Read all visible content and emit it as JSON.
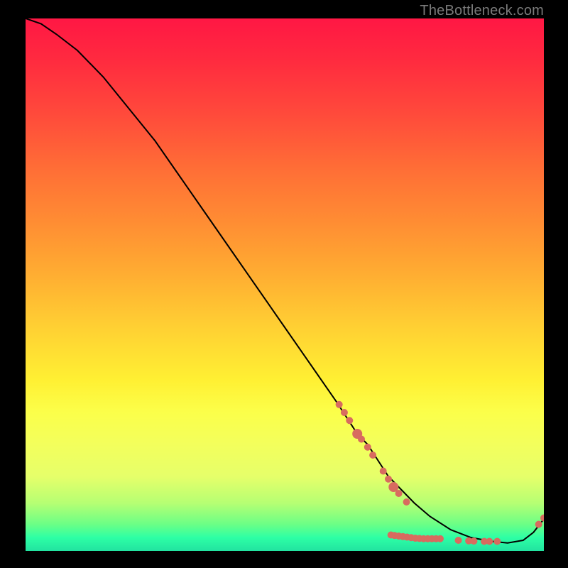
{
  "watermark": "TheBottleneck.com",
  "chart_data": {
    "type": "line",
    "title": "",
    "xlabel": "",
    "ylabel": "",
    "xlim": [
      0,
      100
    ],
    "ylim": [
      0,
      100
    ],
    "grid": false,
    "legend": false,
    "line": {
      "color": "#000000",
      "x": [
        0,
        3,
        6,
        10,
        15,
        20,
        25,
        30,
        35,
        40,
        45,
        50,
        55,
        60,
        62,
        64,
        66,
        68,
        70,
        72,
        75,
        78,
        82,
        86,
        90,
        93,
        96,
        98,
        100
      ],
      "y": [
        100,
        99,
        97,
        94,
        89,
        83,
        77,
        70,
        63,
        56,
        49,
        42,
        35,
        28,
        25,
        22,
        20,
        17,
        14,
        12,
        9,
        6.5,
        4,
        2.5,
        1.8,
        1.5,
        2,
        3.5,
        6
      ]
    },
    "scatter": {
      "color": "#d86b5f",
      "radius_small": 5,
      "radius_large": 7,
      "points": [
        {
          "x": 60.5,
          "y": 27.5,
          "r": 5
        },
        {
          "x": 61.5,
          "y": 26,
          "r": 5
        },
        {
          "x": 62.5,
          "y": 24.5,
          "r": 5
        },
        {
          "x": 64,
          "y": 22,
          "r": 7
        },
        {
          "x": 64.8,
          "y": 21,
          "r": 5
        },
        {
          "x": 66,
          "y": 19.5,
          "r": 5
        },
        {
          "x": 67,
          "y": 18,
          "r": 5
        },
        {
          "x": 69,
          "y": 15,
          "r": 5
        },
        {
          "x": 70,
          "y": 13.5,
          "r": 5
        },
        {
          "x": 71,
          "y": 12,
          "r": 7
        },
        {
          "x": 72,
          "y": 10.8,
          "r": 5
        },
        {
          "x": 73.5,
          "y": 9.2,
          "r": 5
        },
        {
          "x": 70.5,
          "y": 3,
          "r": 5
        },
        {
          "x": 71.2,
          "y": 2.9,
          "r": 5
        },
        {
          "x": 72,
          "y": 2.8,
          "r": 5
        },
        {
          "x": 72.8,
          "y": 2.7,
          "r": 5
        },
        {
          "x": 73.6,
          "y": 2.6,
          "r": 5
        },
        {
          "x": 74.4,
          "y": 2.5,
          "r": 5
        },
        {
          "x": 75.2,
          "y": 2.4,
          "r": 5
        },
        {
          "x": 76,
          "y": 2.35,
          "r": 5
        },
        {
          "x": 76.8,
          "y": 2.3,
          "r": 5
        },
        {
          "x": 77.6,
          "y": 2.3,
          "r": 5
        },
        {
          "x": 78.4,
          "y": 2.3,
          "r": 5
        },
        {
          "x": 79.2,
          "y": 2.3,
          "r": 5
        },
        {
          "x": 80,
          "y": 2.3,
          "r": 5
        },
        {
          "x": 83.5,
          "y": 2,
          "r": 5
        },
        {
          "x": 85.5,
          "y": 1.9,
          "r": 5
        },
        {
          "x": 86.5,
          "y": 1.85,
          "r": 5
        },
        {
          "x": 88.5,
          "y": 1.8,
          "r": 5
        },
        {
          "x": 89.5,
          "y": 1.8,
          "r": 5
        },
        {
          "x": 91,
          "y": 1.8,
          "r": 5
        },
        {
          "x": 99,
          "y": 5,
          "r": 5
        },
        {
          "x": 100,
          "y": 6.2,
          "r": 5
        }
      ]
    }
  }
}
